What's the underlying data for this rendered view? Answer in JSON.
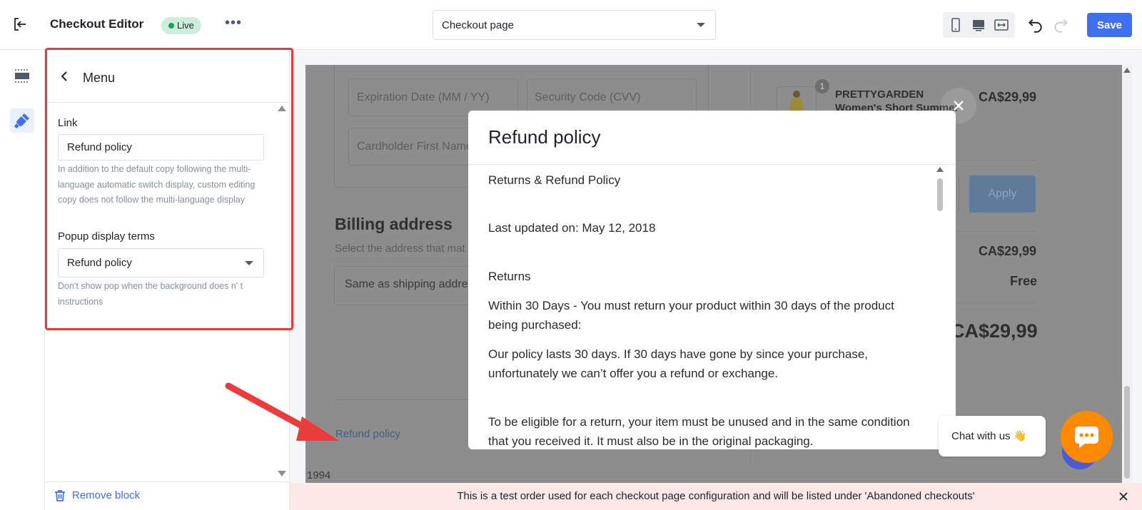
{
  "topbar": {
    "app_title": "Checkout Editor",
    "status_badge": "Live",
    "page_select": "Checkout page",
    "save_label": "Save"
  },
  "sidebar": {
    "title": "Menu",
    "link_label": "Link",
    "link_value": "Refund policy",
    "link_help": "In addition to the default copy following the multi-language automatic switch display, custom editing copy does not follow the multi-language display",
    "popup_label": "Popup display terms",
    "popup_value": "Refund policy",
    "popup_help": "Don't show pop when the background does n' t instructions",
    "remove_label": "Remove block"
  },
  "canvas": {
    "expiration_placeholder": "Expiration Date (MM / YY)",
    "cvv_placeholder": "Security Code (CVV)",
    "first_name_placeholder": "Cardholder First Name",
    "billing_title": "Billing address",
    "billing_subtitle": "Select the address that mat",
    "billing_option": "Same as shipping address",
    "refund_link": "Refund policy",
    "product_qty": "1",
    "product_name": "PRETTYGARDEN Women's Short Summer Dresses...",
    "product_price": "CA$29,99",
    "apply_label": "Apply",
    "subtotal": "CA$29,99",
    "shipping": "Free",
    "total": "CA$29,99",
    "footer_fragment": "1994"
  },
  "modal": {
    "title": "Refund policy",
    "paragraphs": [
      "Returns & Refund Policy",
      "Last updated on: May 12, 2018",
      "Returns",
      "Within 30 Days - You must return your product within 30 days of the product being purchased:",
      "Our policy lasts 30 days. If 30 days have gone by since your purchase, unfortunately we can’t offer you a refund or exchange.",
      "To be eligible for a return, your item must be unused and in the same condition that you received it. It must also be in the original packaging."
    ]
  },
  "chat": {
    "label": "Chat with us 👋"
  },
  "notice": {
    "text": "This is a test order used for each checkout page configuration and will be listed under 'Abandoned checkouts'"
  },
  "colors": {
    "primary": "#3d6fee",
    "live_green": "#16a35b",
    "highlight_red": "#e83a3a",
    "chat_orange": "#ff8a00"
  }
}
